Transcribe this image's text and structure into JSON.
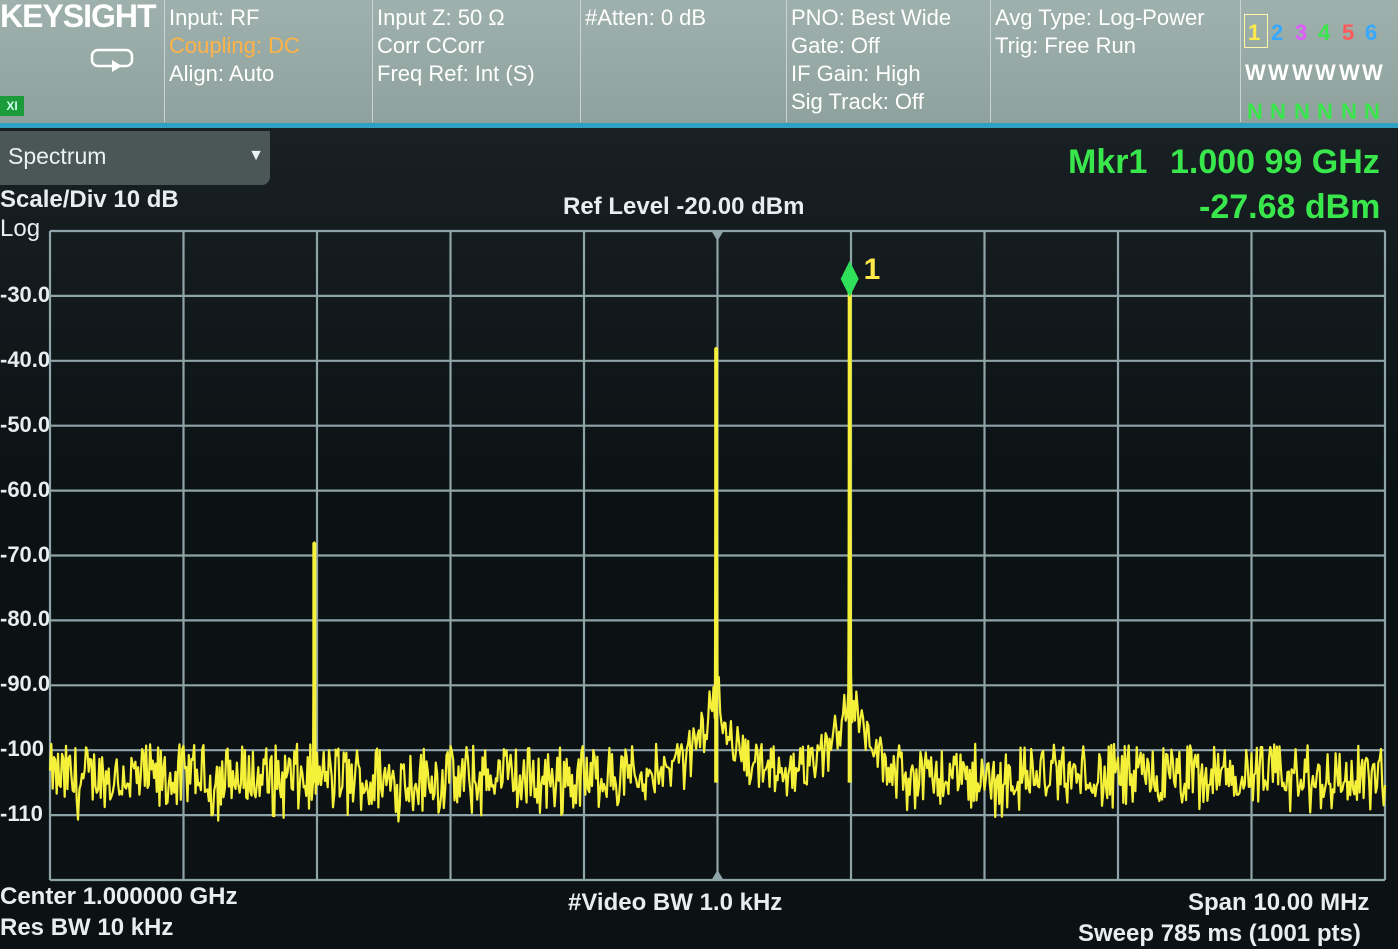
{
  "header": {
    "brand": "KEYSIGHT",
    "col1": [
      "Input: RF",
      "Coupling: DC",
      "Align: Auto"
    ],
    "col2": [
      "Input Z: 50 Ω",
      "Corr CCorr",
      "Freq Ref: Int (S)"
    ],
    "col3": [
      "#Atten: 0 dB"
    ],
    "col4": [
      "PNO: Best Wide",
      "Gate: Off",
      "IF Gain: High",
      "Sig Track: Off"
    ],
    "col5": [
      "Avg Type: Log-Power",
      "Trig: Free Run"
    ],
    "badge": "XI",
    "traces": {
      "numbers": [
        "1",
        "2",
        "3",
        "4",
        "5",
        "6"
      ],
      "number_colors": [
        "#ffe94a",
        "#35a9ff",
        "#e05cff",
        "#39e64b",
        "#ff5a5a",
        "#35a9ff"
      ],
      "row_w": [
        "W",
        "W",
        "W",
        "W",
        "W",
        "W"
      ],
      "row_n": [
        "N",
        "N",
        "N",
        "N",
        "N",
        "N"
      ]
    },
    "icons": [
      "restore-window-icon"
    ]
  },
  "panel": {
    "title": "Spectrum",
    "dropdown_icon": "triangle-down-icon"
  },
  "display": {
    "scale": "Scale/Div 10 dB",
    "mode": "Log",
    "ref_level": "Ref Level -20.00 dBm",
    "marker_label": "Mkr1",
    "marker_freq": "1.000 99 GHz",
    "marker_amp": "-27.68 dBm",
    "marker_number": "1",
    "center": "Center 1.000000 GHz",
    "res_bw": "Res BW 10 kHz",
    "video_bw": "#Video BW 1.0 kHz",
    "span": "Span 10.00 MHz",
    "sweep": "Sweep 785 ms (1001 pts)",
    "colors": {
      "trace": "#f5f03a",
      "grid": "#8fa4a8",
      "marker": "#2ee05a",
      "marker_text": "#39e64b"
    }
  },
  "chart_data": {
    "type": "line",
    "title": "Ref Level -20.00 dBm",
    "xlabel": "",
    "ylabel": "",
    "x_unit": "GHz",
    "y_unit": "dBm",
    "xlim": [
      0.995,
      1.005
    ],
    "ylim": [
      -120,
      -20
    ],
    "y_tick_labels": [
      "-30.0",
      "-40.0",
      "-50.0",
      "-60.0",
      "-70.0",
      "-80.0",
      "-90.0",
      "-100",
      "-110"
    ],
    "y_ticks": [
      -30,
      -40,
      -50,
      -60,
      -70,
      -80,
      -90,
      -100,
      -110
    ],
    "grid": true,
    "noise_floor_dbm": -105,
    "series": [
      {
        "points": [
          {
            "x": 0.99698,
            "y": -68
          },
          {
            "x": 0.99999,
            "y": -38
          },
          {
            "x": 1.00099,
            "y": -27.68
          }
        ]
      }
    ],
    "marker": {
      "x": 1.00099,
      "y": -27.68
    }
  }
}
